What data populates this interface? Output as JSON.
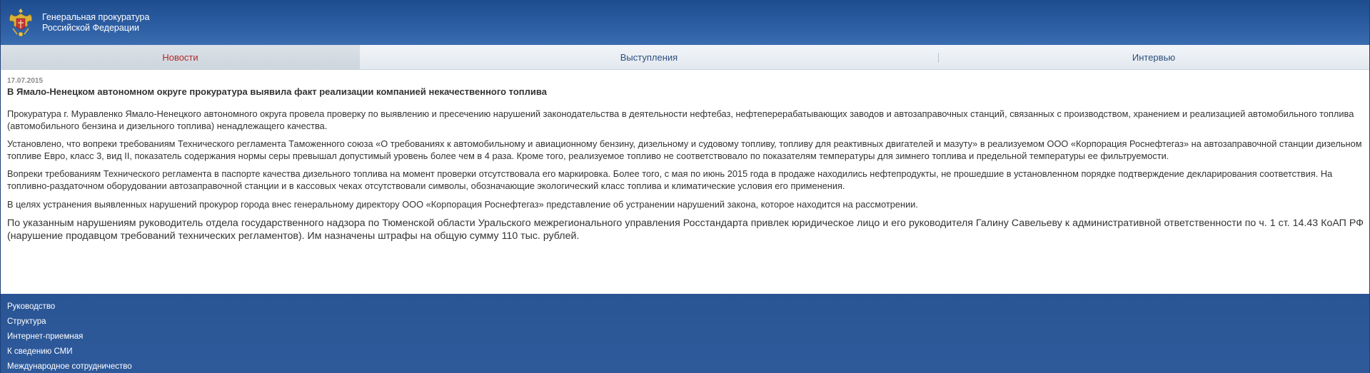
{
  "header": {
    "org_line1": "Генеральная прокуратура",
    "org_line2": "Российской Федерации",
    "emblem_icon": "prosecutor-emblem-icon"
  },
  "tabs": [
    {
      "label": "Новости",
      "active": true
    },
    {
      "label": "Выступления",
      "active": false
    },
    {
      "label": "Интервью",
      "active": false
    }
  ],
  "article": {
    "date": "17.07.2015",
    "title": "В Ямало-Ненецком автономном округе прокуратура выявила факт реализации компанией некачественного топлива",
    "paragraphs": [
      "Прокуратура г. Муравленко Ямало-Ненецкого автономного округа провела проверку по выявлению и пресечению нарушений законодательства в деятельности нефтебаз, нефтеперерабатывающих заводов и автозаправочных станций, связанных с производством, хранением и реализацией автомобильного топлива (автомобильного бензина и дизельного топлива) ненадлежащего качества.",
      "Установлено, что вопреки требованиям Технического регламента Таможенного союза «О требованиях к автомобильному и авиационному бензину, дизельному и судовому топливу, топливу для реактивных двигателей и мазуту» в реализуемом ООО «Корпорация Роснефтегаз» на автозаправочной станции дизельном топливе Евро, класс 3, вид II, показатель содержания нормы серы превышал допустимый уровень более чем в 4 раза. Кроме того, реализуемое топливо не соответствовало по показателям температуры для зимнего топлива и предельной температуры ее фильтруемости.",
      "Вопреки требованиям Технического регламента в паспорте качества дизельного топлива на момент проверки отсутствовала его маркировка. Более того, с мая по июнь 2015 года в продаже находились нефтепродукты, не прошедшие в установленном порядке подтверждение декларирования соответствия. На топливно-раздаточном оборудовании автозаправочной станции и в кассовых чеках отсутствовали символы, обозначающие экологический класс топлива и климатические условия его применения.",
      "В целях устранения выявленных нарушений прокурор города внес генеральному директору ООО «Корпорация Роснефтегаз» представление об устранении нарушений закона, которое находится на рассмотрении.",
      "По указанным нарушениям руководитель отдела государственного надзора по Тюменской области Уральского межрегионального управления Росстандарта привлек юридическое лицо и его руководителя Галину Савельеву к административной ответственности по ч. 1 ст. 14.43 КоАП РФ (нарушение продавцом требований технических регламентов). Им назначены штрафы на общую сумму 110 тыс. рублей."
    ]
  },
  "footer": {
    "links": [
      "Руководство",
      "Структура",
      "Интернет-приемная",
      "К сведению СМИ",
      "Международное сотрудничество"
    ]
  },
  "colors": {
    "brand_blue": "#2c5192",
    "active_tab_text": "#b3272a",
    "tab_text": "#2b4f7e"
  }
}
